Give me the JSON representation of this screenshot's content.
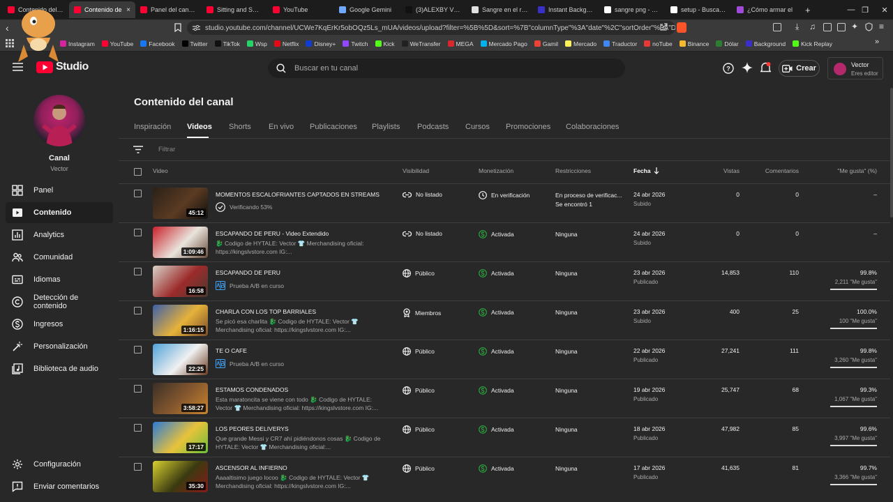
{
  "browser": {
    "tabs": [
      {
        "label": "Contenido del ca",
        "color": "#ff0033",
        "active": false
      },
      {
        "label": "Contenido de",
        "color": "#ff0033",
        "active": true
      },
      {
        "label": "Panel del canal -",
        "color": "#ff0033",
        "active": false
      },
      {
        "label": "Sitting and Smilin",
        "color": "#ff0033",
        "active": false
      },
      {
        "label": "YouTube",
        "color": "#ff0033",
        "active": false
      },
      {
        "label": "Google Gemini",
        "color": "#6fa8ff",
        "active": false
      },
      {
        "label": "(3)ALEXBY VS EL",
        "color": "#111111",
        "active": false
      },
      {
        "label": "Sangre en el rost",
        "color": "#e0e0e0",
        "active": false
      },
      {
        "label": "Instant Backgrour",
        "color": "#3b2fc9",
        "active": false
      },
      {
        "label": "sangre png - Bus",
        "color": "#ffffff",
        "active": false
      },
      {
        "label": "setup - Buscar co",
        "color": "#ffffff",
        "active": false
      },
      {
        "label": "¿Cómo armar el",
        "color": "#a149d8",
        "active": false
      }
    ],
    "close_glyph": "×",
    "newtab_glyph": "+",
    "url": "studio.youtube.com/channel/UCWe7KqErKr5obOQz5Ls_mUA/videos/upload?filter=%5B%5D&sort=%7B\"columnType\"%3A\"date\"%2C\"sortOrder\"%3A\"DES...",
    "bookmarks": [
      {
        "label": "Instagram",
        "color": "#d6249f"
      },
      {
        "label": "YouTube",
        "color": "#ff0033"
      },
      {
        "label": "Facebook",
        "color": "#1877f2"
      },
      {
        "label": "Twitter",
        "color": "#000000"
      },
      {
        "label": "TikTok",
        "color": "#111111"
      },
      {
        "label": "Wsp",
        "color": "#25d366"
      },
      {
        "label": "Netflix",
        "color": "#e50914"
      },
      {
        "label": "Disney+",
        "color": "#113ccf"
      },
      {
        "label": "Twitch",
        "color": "#9146ff"
      },
      {
        "label": "Kick",
        "color": "#53fc18"
      },
      {
        "label": "WeTransfer",
        "color": "#222222"
      },
      {
        "label": "MEGA",
        "color": "#d9272e"
      },
      {
        "label": "Mercado Pago",
        "color": "#00b1ea"
      },
      {
        "label": "Gamil",
        "color": "#ea4335"
      },
      {
        "label": "Mercado",
        "color": "#fff159"
      },
      {
        "label": "Traductor",
        "color": "#4285f4"
      },
      {
        "label": "noTube",
        "color": "#e53935"
      },
      {
        "label": "Binance",
        "color": "#f3ba2f"
      },
      {
        "label": "Dólar",
        "color": "#2e7d32"
      },
      {
        "label": "Background",
        "color": "#3b2fc9"
      },
      {
        "label": "Kick Replay",
        "color": "#53fc18"
      }
    ]
  },
  "studio": {
    "logo_text": "Studio",
    "search_placeholder": "Buscar en tu canal",
    "create_label": "Crear",
    "user_name": "Vector",
    "user_role": "Eres editor"
  },
  "sidebar": {
    "channel_label": "Canal",
    "channel_name": "Vector",
    "items": [
      {
        "label": "Panel",
        "icon": "dashboard-icon"
      },
      {
        "label": "Contenido",
        "icon": "content-icon"
      },
      {
        "label": "Analytics",
        "icon": "analytics-icon"
      },
      {
        "label": "Comunidad",
        "icon": "community-icon"
      },
      {
        "label": "Idiomas",
        "icon": "subtitles-icon"
      },
      {
        "label": "Detección de contenido",
        "icon": "copyright-icon"
      },
      {
        "label": "Ingresos",
        "icon": "dollar-icon"
      },
      {
        "label": "Personalización",
        "icon": "magic-wand-icon"
      },
      {
        "label": "Biblioteca de audio",
        "icon": "audio-library-icon"
      }
    ],
    "settings_label": "Configuración",
    "feedback_label": "Enviar comentarios"
  },
  "content": {
    "title": "Contenido del canal",
    "tabs": [
      "Inspiración",
      "Videos",
      "Shorts",
      "En vivo",
      "Publicaciones",
      "Playlists",
      "Podcasts",
      "Cursos",
      "Promociones",
      "Colaboraciones"
    ],
    "active_tab": "Videos",
    "filter_placeholder": "Filtrar",
    "headers": {
      "video": "Video",
      "visibility": "Visibilidad",
      "monetization": "Monetización",
      "restrictions": "Restricciones",
      "date": "Fecha",
      "views": "Vistas",
      "comments": "Comentarios",
      "likes": "\"Me gusta\" (%)"
    },
    "rows": [
      {
        "title": "MOMENTOS ESCALOFRIANTES CAPTADOS EN STREAMS",
        "desc": "",
        "abtest": "",
        "status": "Verificando 53%",
        "duration": "45:12",
        "visibility": "No listado",
        "vis_icon": "unlisted-link-icon",
        "monetization": "En verificación",
        "mon_icon": "clock-icon",
        "restriction": "En proceso de verificac...",
        "restriction2": "Se encontró 1",
        "date": "24 abr 2026",
        "date_status": "Subido",
        "views": "0",
        "comments": "0",
        "likes": "–",
        "likes_sub": "",
        "like_ratio": null,
        "thumb": [
          "#2a2118",
          "#5b3b22",
          "#101010"
        ]
      },
      {
        "title": "ESCAPANDO DE PERU - Video Extendido",
        "desc": "🐉 Codigo de HYTALE: Vector 👕 Merchandising oficial: https://kingslvstore.com IG:...",
        "abtest": "",
        "status": "",
        "duration": "1:09:46",
        "visibility": "No listado",
        "vis_icon": "unlisted-link-icon",
        "monetization": "Activada",
        "mon_icon": "dollar-icon",
        "restriction": "Ninguna",
        "restriction2": "",
        "date": "24 abr 2026",
        "date_status": "Subido",
        "views": "0",
        "comments": "0",
        "likes": "–",
        "likes_sub": "",
        "like_ratio": null,
        "thumb": [
          "#c9202a",
          "#e9e4dc",
          "#6b4b3a"
        ]
      },
      {
        "title": "ESCAPANDO DE PERU",
        "desc": "",
        "abtest": "Prueba A/B en curso",
        "status": "",
        "duration": "16:58",
        "visibility": "Público",
        "vis_icon": "globe-icon",
        "monetization": "Activada",
        "mon_icon": "dollar-icon",
        "restriction": "Ninguna",
        "restriction2": "",
        "date": "23 abr 2026",
        "date_status": "Publicado",
        "views": "14,853",
        "comments": "110",
        "likes": "99.8%",
        "likes_sub": "2,211 \"Me gusta\"",
        "like_ratio": 0.998,
        "thumb": [
          "#d8d2c8",
          "#9c2b2b",
          "#4a3a30"
        ]
      },
      {
        "title": "CHARLA CON LOS TOP BARRIALES",
        "desc": "Se picó esa charlita 🐉 Codigo de HYTALE: Vector 👕 Merchandising oficial: https://kingslvstore.com IG:...",
        "abtest": "",
        "status": "",
        "duration": "1:16:15",
        "visibility": "Miembros",
        "vis_icon": "members-icon",
        "monetization": "Activada",
        "mon_icon": "dollar-icon",
        "restriction": "Ninguna",
        "restriction2": "",
        "date": "23 abr 2026",
        "date_status": "Subido",
        "views": "400",
        "comments": "25",
        "likes": "100.0%",
        "likes_sub": "100 \"Me gusta\"",
        "like_ratio": 1.0,
        "thumb": [
          "#3d5fa8",
          "#e6b23a",
          "#7a4a2a"
        ]
      },
      {
        "title": "TE O CAFE",
        "desc": "",
        "abtest": "Prueba A/B en curso",
        "status": "",
        "duration": "22:25",
        "visibility": "Público",
        "vis_icon": "globe-icon",
        "monetization": "Activada",
        "mon_icon": "dollar-icon",
        "restriction": "Ninguna",
        "restriction2": "",
        "date": "22 abr 2026",
        "date_status": "Publicado",
        "views": "27,241",
        "comments": "111",
        "likes": "99.8%",
        "likes_sub": "3,260 \"Me gusta\"",
        "like_ratio": 0.998,
        "thumb": [
          "#4fa3d9",
          "#f0f0f0",
          "#6b3a20"
        ]
      },
      {
        "title": "ESTAMOS CONDENADOS",
        "desc": "Esta maratoncita se viene con todo 🐉 Codigo de HYTALE: Vector 👕 Merchandising oficial: https://kingslvstore.com IG:...",
        "abtest": "",
        "status": "",
        "duration": "3:58:27",
        "visibility": "Público",
        "vis_icon": "globe-icon",
        "monetization": "Activada",
        "mon_icon": "dollar-icon",
        "restriction": "Ninguna",
        "restriction2": "",
        "date": "19 abr 2026",
        "date_status": "Publicado",
        "views": "25,747",
        "comments": "68",
        "likes": "99.3%",
        "likes_sub": "1,067 \"Me gusta\"",
        "like_ratio": 0.993,
        "thumb": [
          "#3a2f28",
          "#8a5a2e",
          "#c9842f"
        ]
      },
      {
        "title": "LOS PEORES DELIVERYS",
        "desc": "Que grande Messi y CR7 ahí pidiéndonos cosas 🐉 Codigo de HYTALE: Vector 👕 Merchandising oficial:...",
        "abtest": "",
        "status": "",
        "duration": "17:17",
        "visibility": "Público",
        "vis_icon": "globe-icon",
        "monetization": "Activada",
        "mon_icon": "dollar-icon",
        "restriction": "Ninguna",
        "restriction2": "",
        "date": "18 abr 2026",
        "date_status": "Publicado",
        "views": "47,982",
        "comments": "85",
        "likes": "99.6%",
        "likes_sub": "3,997 \"Me gusta\"",
        "like_ratio": 0.996,
        "thumb": [
          "#2c7ad6",
          "#e8c23a",
          "#6bbf3a"
        ]
      },
      {
        "title": "ASCENSOR AL INFIERNO",
        "desc": "Aaaaltisimo juego locoo 🐉 Codigo de HYTALE: Vector 👕 Merchandising oficial: https://kingslvstore.com IG:...",
        "abtest": "",
        "status": "",
        "duration": "35:30",
        "visibility": "Público",
        "vis_icon": "globe-icon",
        "monetization": "Activada",
        "mon_icon": "dollar-icon",
        "restriction": "Ninguna",
        "restriction2": "",
        "date": "17 abr 2026",
        "date_status": "Publicado",
        "views": "41,635",
        "comments": "81",
        "likes": "99.7%",
        "likes_sub": "3,366 \"Me gusta\"",
        "like_ratio": 0.997,
        "thumb": [
          "#d8d030",
          "#3a3a10",
          "#8a1a1a"
        ]
      }
    ]
  }
}
